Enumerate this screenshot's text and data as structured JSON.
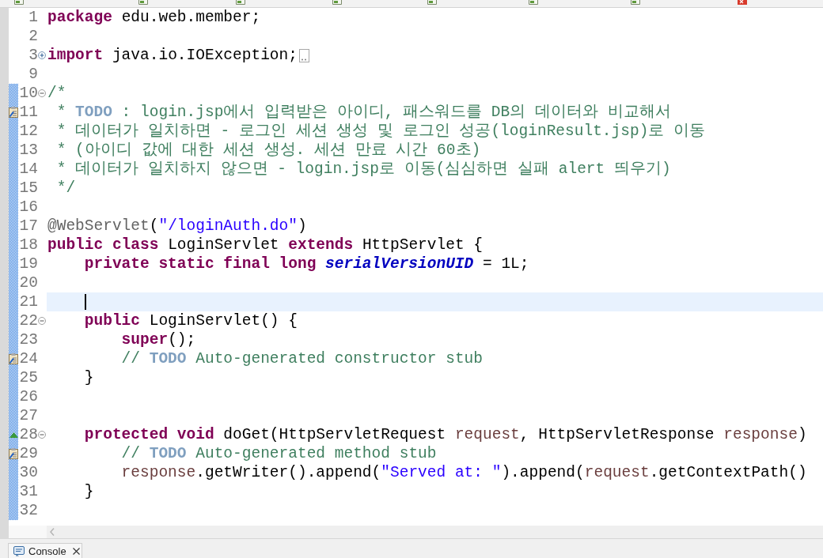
{
  "editor_tabs": [
    {
      "error": false
    },
    {
      "error": false
    },
    {
      "error": false
    },
    {
      "error": false
    },
    {
      "error": false
    },
    {
      "error": false
    },
    {
      "error": false
    },
    {
      "error": true
    }
  ],
  "editor": {
    "lines": [
      {
        "number": "1",
        "changed": false,
        "current": false,
        "tokens": [
          {
            "kind": "keyword",
            "text": "package "
          },
          {
            "kind": "plain",
            "text": "edu.web.member;"
          }
        ]
      },
      {
        "number": "2",
        "changed": false,
        "current": false
      },
      {
        "number": "3",
        "changed": false,
        "current": false,
        "folded": true,
        "tokens": [
          {
            "kind": "keyword",
            "text": "import "
          },
          {
            "kind": "plain",
            "text": "java.io.IOException;"
          }
        ]
      },
      {
        "number": "9",
        "changed": false,
        "current": false
      },
      {
        "number": "10",
        "changed": true,
        "current": false,
        "folded": false,
        "tokens": [
          {
            "kind": "comment",
            "text": "/*"
          }
        ]
      },
      {
        "number": "11",
        "changed": true,
        "current": false,
        "marker": {
          "kind": "task"
        },
        "tokens": [
          {
            "kind": "comment",
            "text": " * "
          },
          {
            "kind": "todo",
            "text": "TODO"
          },
          {
            "kind": "comment",
            "text": " : login.jsp에서 입력받은 아이디, 패스워드를 DB의 데이터와 비교해서"
          }
        ]
      },
      {
        "number": "12",
        "changed": true,
        "current": false,
        "tokens": [
          {
            "kind": "comment",
            "text": " * 데이터가 일치하면 - 로그인 세션 생성 및 로그인 성공(loginResult.jsp)로 이동"
          }
        ]
      },
      {
        "number": "13",
        "changed": true,
        "current": false,
        "tokens": [
          {
            "kind": "comment",
            "text": " * (아이디 값에 대한 세션 생성. 세션 만료 시간 60초)"
          }
        ]
      },
      {
        "number": "14",
        "changed": true,
        "current": false,
        "tokens": [
          {
            "kind": "comment",
            "text": " * 데이터가 일치하지 않으면 - login.jsp로 이동(심심하면 실패 alert 띄우기)"
          }
        ]
      },
      {
        "number": "15",
        "changed": true,
        "current": false,
        "tokens": [
          {
            "kind": "comment",
            "text": " */"
          }
        ]
      },
      {
        "number": "16",
        "changed": true,
        "current": false
      },
      {
        "number": "17",
        "changed": true,
        "current": false,
        "tokens": [
          {
            "kind": "annotation",
            "text": "@WebServlet"
          },
          {
            "kind": "plain",
            "text": "("
          },
          {
            "kind": "string",
            "text": "\"/loginAuth.do\""
          },
          {
            "kind": "plain",
            "text": ")"
          }
        ]
      },
      {
        "number": "18",
        "changed": true,
        "current": false,
        "tokens": [
          {
            "kind": "keyword",
            "text": "public class "
          },
          {
            "kind": "plain",
            "text": "LoginServlet "
          },
          {
            "kind": "keyword",
            "text": "extends "
          },
          {
            "kind": "plain",
            "text": "HttpServlet {"
          }
        ],
        "children": [
          {
            "number": "19",
            "changed": true,
            "current": false,
            "tokens": [
              {
                "kind": "keyword",
                "text": "private static final long "
              },
              {
                "kind": "field",
                "text": "serialVersionUID"
              },
              {
                "kind": "plain",
                "text": " = 1L;"
              }
            ]
          },
          {
            "number": "20",
            "changed": true,
            "current": false
          },
          {
            "number": "21",
            "changed": true,
            "current": true,
            "tokens": [
              {
                "kind": "caret"
              }
            ]
          },
          {
            "number": "22",
            "changed": true,
            "current": false,
            "folded": false,
            "tokens": [
              {
                "kind": "keyword",
                "text": "public "
              },
              {
                "kind": "plain",
                "text": "LoginServlet() {"
              }
            ],
            "children": [
              {
                "number": "23",
                "changed": true,
                "current": false,
                "tokens": [
                  {
                    "kind": "keyword",
                    "text": "super"
                  },
                  {
                    "kind": "plain",
                    "text": "();"
                  }
                ]
              },
              {
                "number": "24",
                "changed": true,
                "current": false,
                "marker": {
                  "kind": "task"
                },
                "tokens": [
                  {
                    "kind": "comment",
                    "text": "// "
                  },
                  {
                    "kind": "todo",
                    "text": "TODO"
                  },
                  {
                    "kind": "comment",
                    "text": " Auto-generated constructor stub"
                  }
                ]
              }
            ]
          },
          {
            "number": "25",
            "changed": true,
            "current": false,
            "tokens": [
              {
                "kind": "plain",
                "text": "}"
              }
            ]
          },
          {
            "number": "26",
            "changed": true,
            "current": false
          },
          {
            "number": "27",
            "changed": true,
            "current": false
          },
          {
            "number": "28",
            "changed": true,
            "current": false,
            "marker": {
              "kind": "override"
            },
            "folded": false,
            "tokens": [
              {
                "kind": "keyword",
                "text": "protected void "
              },
              {
                "kind": "plain",
                "text": "doGet(HttpServletRequest "
              },
              {
                "kind": "param",
                "text": "request"
              },
              {
                "kind": "plain",
                "text": ", HttpServletResponse "
              },
              {
                "kind": "param",
                "text": "response"
              },
              {
                "kind": "plain",
                "text": ")"
              }
            ],
            "children": [
              {
                "number": "29",
                "changed": true,
                "current": false,
                "marker": {
                  "kind": "task"
                },
                "tokens": [
                  {
                    "kind": "comment",
                    "text": "// "
                  },
                  {
                    "kind": "todo",
                    "text": "TODO"
                  },
                  {
                    "kind": "comment",
                    "text": " Auto-generated method stub"
                  }
                ]
              },
              {
                "number": "30",
                "changed": true,
                "current": false,
                "tokens": [
                  {
                    "kind": "param",
                    "text": "response"
                  },
                  {
                    "kind": "plain",
                    "text": ".getWriter().append("
                  },
                  {
                    "kind": "string",
                    "text": "\"Served at: \""
                  },
                  {
                    "kind": "plain",
                    "text": ").append("
                  },
                  {
                    "kind": "param",
                    "text": "request"
                  },
                  {
                    "kind": "plain",
                    "text": ".getContextPath()"
                  }
                ]
              }
            ]
          },
          {
            "number": "31",
            "changed": true,
            "current": false,
            "tokens": [
              {
                "kind": "plain",
                "text": "}"
              }
            ]
          },
          {
            "number": "32",
            "changed": true,
            "current": false
          }
        ]
      }
    ]
  },
  "bottom_panel": {
    "tabs": [
      {
        "label": "Console"
      }
    ]
  }
}
